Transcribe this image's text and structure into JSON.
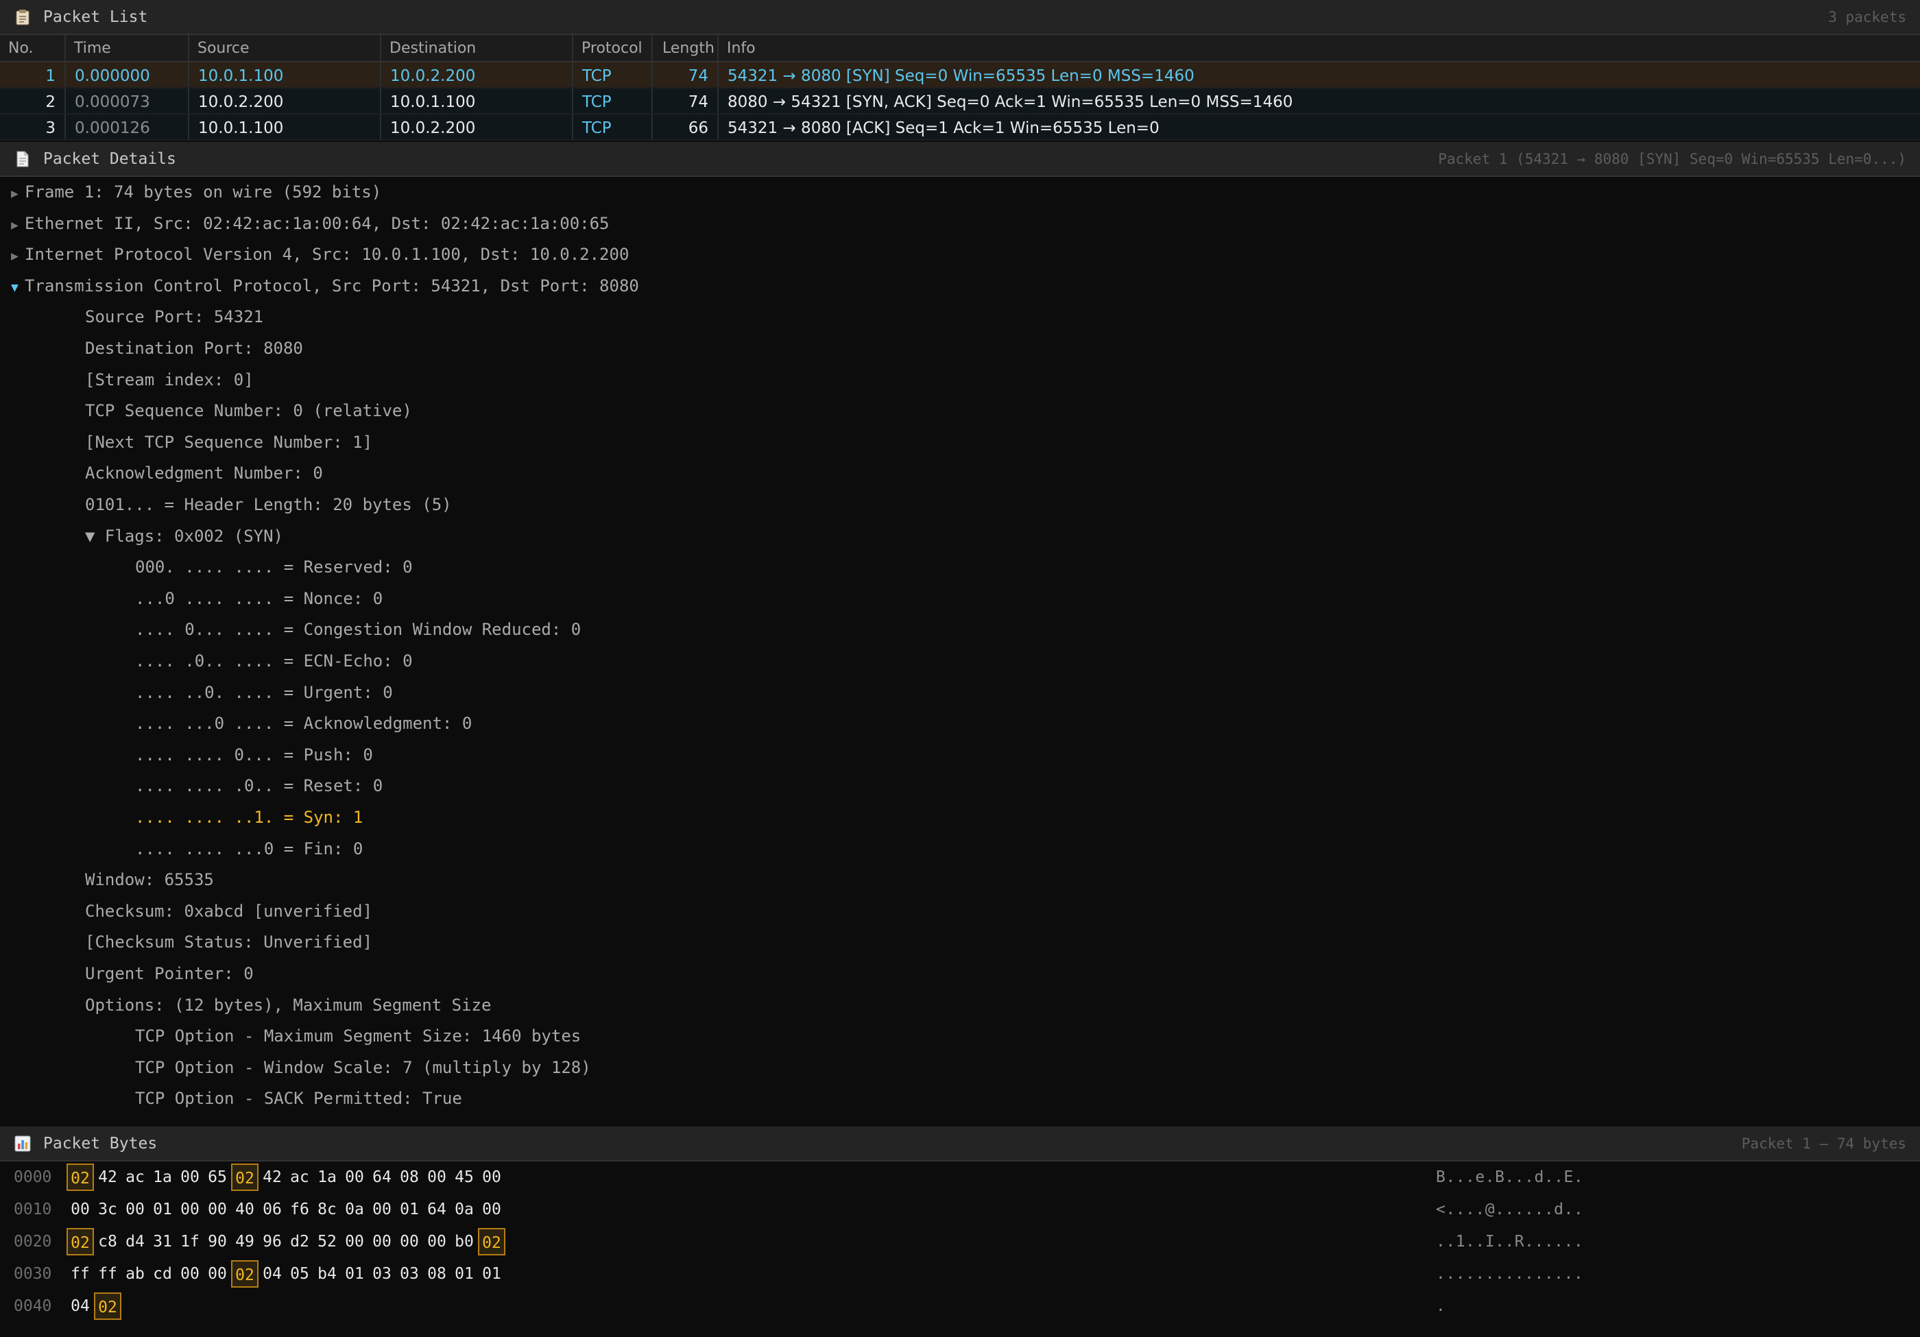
{
  "packet_list": {
    "icon": "clipboard-icon",
    "title": "Packet List",
    "count_text": "3 packets",
    "columns": [
      "No.",
      "Time",
      "Source",
      "Destination",
      "Protocol",
      "Length",
      "Info"
    ],
    "rows": [
      {
        "no": "1",
        "time": "0.000000",
        "source": "10.0.1.100",
        "destination": "10.0.2.200",
        "protocol": "TCP",
        "length": "74",
        "info": "54321 → 8080 [SYN] Seq=0 Win=65535 Len=0 MSS=1460",
        "selected": true
      },
      {
        "no": "2",
        "time": "0.000073",
        "source": "10.0.2.200",
        "destination": "10.0.1.100",
        "protocol": "TCP",
        "length": "74",
        "info": "8080 → 54321 [SYN, ACK] Seq=0 Ack=1 Win=65535 Len=0 MSS=1460",
        "selected": false
      },
      {
        "no": "3",
        "time": "0.000126",
        "source": "10.0.1.100",
        "destination": "10.0.2.200",
        "protocol": "TCP",
        "length": "66",
        "info": "54321 → 8080 [ACK] Seq=1 Ack=1 Win=65535 Len=0",
        "selected": false
      }
    ]
  },
  "packet_details": {
    "icon": "document-icon",
    "title": "Packet Details",
    "subtitle": "Packet 1 (54321 → 8080 [SYN] Seq=0 Win=65535 Len=0...)",
    "lines": [
      {
        "level": 0,
        "toggle": "collapsed",
        "text": "Frame 1: 74 bytes on wire (592 bits)"
      },
      {
        "level": 0,
        "toggle": "collapsed",
        "text": "Ethernet II, Src: 02:42:ac:1a:00:64, Dst: 02:42:ac:1a:00:65"
      },
      {
        "level": 0,
        "toggle": "collapsed",
        "text": "Internet Protocol Version 4, Src: 10.0.1.100, Dst: 10.0.2.200"
      },
      {
        "level": 0,
        "toggle": "expanded",
        "text": "Transmission Control Protocol, Src Port: 54321, Dst Port: 8080"
      },
      {
        "level": 1,
        "text": "Source Port: 54321"
      },
      {
        "level": 1,
        "text": "Destination Port: 8080"
      },
      {
        "level": 1,
        "text": "[Stream index: 0]"
      },
      {
        "level": 1,
        "text": "TCP Sequence Number: 0 (relative)"
      },
      {
        "level": 1,
        "text": "[Next TCP Sequence Number: 1]"
      },
      {
        "level": 1,
        "text": "Acknowledgment Number: 0"
      },
      {
        "level": 1,
        "text": "0101... = Header Length: 20 bytes (5)"
      },
      {
        "level": 1,
        "text": "▼ Flags: 0x002 (SYN)"
      },
      {
        "level": 2,
        "text": "000. .... .... = Reserved: 0"
      },
      {
        "level": 2,
        "text": "...0 .... .... = Nonce: 0"
      },
      {
        "level": 2,
        "text": ".... 0... .... = Congestion Window Reduced: 0"
      },
      {
        "level": 2,
        "text": ".... .0.. .... = ECN-Echo: 0"
      },
      {
        "level": 2,
        "text": ".... ..0. .... = Urgent: 0"
      },
      {
        "level": 2,
        "text": ".... ...0 .... = Acknowledgment: 0"
      },
      {
        "level": 2,
        "text": ".... .... 0... = Push: 0"
      },
      {
        "level": 2,
        "text": ".... .... .0.. = Reset: 0"
      },
      {
        "level": 2,
        "text": ".... .... ..1. = Syn: 1",
        "highlight": true
      },
      {
        "level": 2,
        "text": ".... .... ...0 = Fin: 0"
      },
      {
        "level": 1,
        "text": "Window: 65535"
      },
      {
        "level": 1,
        "text": "Checksum: 0xabcd [unverified]"
      },
      {
        "level": 1,
        "text": "[Checksum Status: Unverified]"
      },
      {
        "level": 1,
        "text": "Urgent Pointer: 0"
      },
      {
        "level": 1,
        "text": "Options: (12 bytes), Maximum Segment Size"
      },
      {
        "level": 2,
        "text": "TCP Option - Maximum Segment Size: 1460 bytes"
      },
      {
        "level": 2,
        "text": "TCP Option - Window Scale: 7 (multiply by 128)"
      },
      {
        "level": 2,
        "text": "TCP Option - SACK Permitted: True"
      }
    ]
  },
  "packet_bytes": {
    "icon": "bar-chart-icon",
    "title": "Packet Bytes",
    "subtitle": "Packet 1 — 74 bytes",
    "rows": [
      {
        "offset": "0000",
        "bytes": [
          "02",
          "42",
          "ac",
          "1a",
          "00",
          "65",
          "02",
          "42",
          "ac",
          "1a",
          "00",
          "64",
          "08",
          "00",
          "45",
          "00"
        ],
        "highlight": [
          0,
          6
        ],
        "ascii": "B...e.B...d..E."
      },
      {
        "offset": "0010",
        "bytes": [
          "00",
          "3c",
          "00",
          "01",
          "00",
          "00",
          "40",
          "06",
          "f6",
          "8c",
          "0a",
          "00",
          "01",
          "64",
          "0a",
          "00"
        ],
        "highlight": [],
        "ascii": "<....@......d.."
      },
      {
        "offset": "0020",
        "bytes": [
          "02",
          "c8",
          "d4",
          "31",
          "1f",
          "90",
          "49",
          "96",
          "d2",
          "52",
          "00",
          "00",
          "00",
          "00",
          "b0",
          "02"
        ],
        "highlight": [
          0,
          15
        ],
        "ascii": "..1..I..R......"
      },
      {
        "offset": "0030",
        "bytes": [
          "ff",
          "ff",
          "ab",
          "cd",
          "00",
          "00",
          "02",
          "04",
          "05",
          "b4",
          "01",
          "03",
          "03",
          "08",
          "01",
          "01"
        ],
        "highlight": [
          6
        ],
        "ascii": "..............."
      },
      {
        "offset": "0040",
        "bytes": [
          "04",
          "02"
        ],
        "highlight": [
          1
        ],
        "ascii": "."
      }
    ]
  }
}
